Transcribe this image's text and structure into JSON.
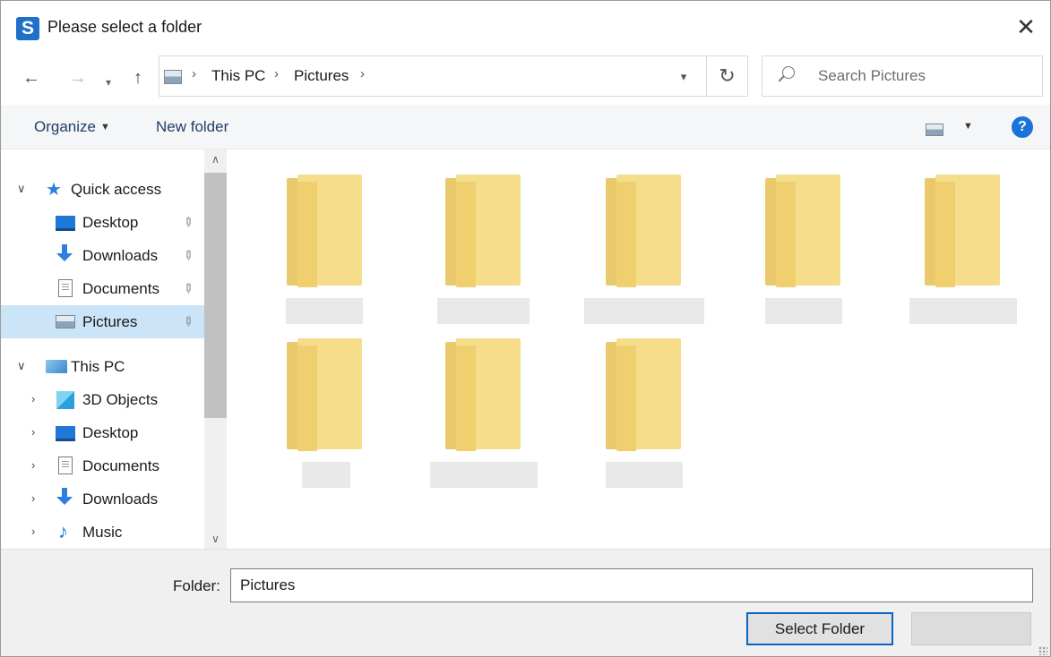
{
  "window": {
    "app_icon_letter": "S",
    "title": "Please select a folder",
    "close_glyph": "✕"
  },
  "navigation": {
    "back_glyph": "←",
    "forward_glyph": "→",
    "recent_glyph": "▾",
    "up_glyph": "↑",
    "breadcrumb": [
      "This PC",
      "Pictures"
    ],
    "separator_glyph": "›",
    "refresh_glyph": "↻",
    "search_placeholder": "Search Pictures"
  },
  "toolbar": {
    "organize_label": "Organize",
    "new_folder_label": "New folder",
    "help_glyph": "?"
  },
  "sidebar": {
    "quick_access": {
      "label": "Quick access",
      "items": [
        {
          "label": "Desktop",
          "icon": "desktop-icon",
          "pinned": true
        },
        {
          "label": "Downloads",
          "icon": "downloads-icon",
          "pinned": true
        },
        {
          "label": "Documents",
          "icon": "documents-icon",
          "pinned": true
        },
        {
          "label": "Pictures",
          "icon": "pictures-icon",
          "pinned": true,
          "selected": true
        }
      ]
    },
    "this_pc": {
      "label": "This PC",
      "items": [
        {
          "label": "3D Objects",
          "icon": "3d-objects-icon"
        },
        {
          "label": "Desktop",
          "icon": "desktop-icon"
        },
        {
          "label": "Documents",
          "icon": "documents-icon"
        },
        {
          "label": "Downloads",
          "icon": "downloads-icon"
        },
        {
          "label": "Music",
          "icon": "music-icon"
        }
      ]
    }
  },
  "content": {
    "folders_count_note": "8 folders with redacted names"
  },
  "footer": {
    "folder_label": "Folder:",
    "folder_value": "Pictures",
    "select_button_label": "Select Folder",
    "cancel_button_label": ""
  },
  "colors": {
    "accent": "#0a64c4",
    "selection": "#cce4f7",
    "folder": "#f6dd8b",
    "help": "#1a73d9"
  }
}
